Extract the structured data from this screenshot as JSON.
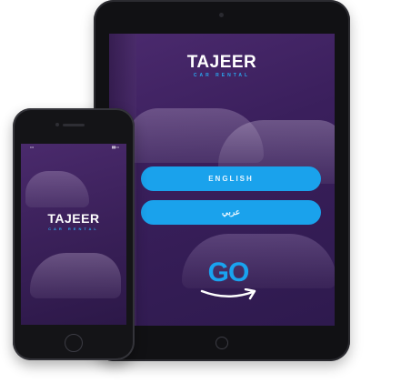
{
  "brand": {
    "name": "TAJEER",
    "tagline": "CAR RENTAL"
  },
  "tablet": {
    "buttons": {
      "english": "ENGLISH",
      "arabic": "عربي"
    },
    "go_label": "GO"
  },
  "phone": {
    "status_left": "•••",
    "status_right": "▮▮▭"
  },
  "colors": {
    "accent": "#1aa2ec",
    "background_purple": "#3a1f5c"
  }
}
